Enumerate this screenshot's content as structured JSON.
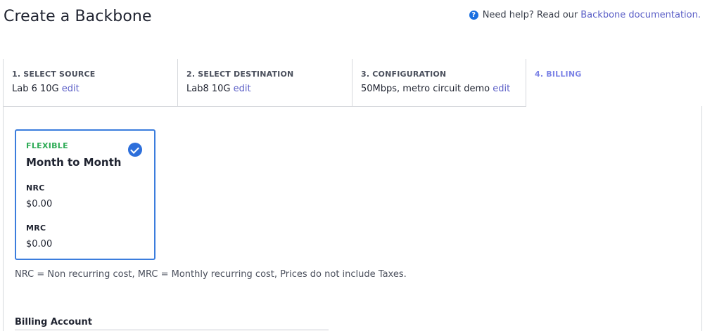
{
  "header": {
    "title": "Create a Backbone",
    "help_prefix": "Need help? Read our",
    "help_link": "Backbone documentation."
  },
  "steps": [
    {
      "label": "1. SELECT SOURCE",
      "value": "Lab 6 10G",
      "edit": "edit"
    },
    {
      "label": "2. SELECT DESTINATION",
      "value": "Lab8 10G",
      "edit": "edit"
    },
    {
      "label": "3. CONFIGURATION",
      "value": "50Mbps, metro circuit demo",
      "edit": "edit"
    },
    {
      "label": "4. BILLING"
    }
  ],
  "progress_fraction": 0.875,
  "plan": {
    "type": "FLEXIBLE",
    "name": "Month to Month",
    "nrc_label": "NRC",
    "nrc_value": "$0.00",
    "mrc_label": "MRC",
    "mrc_value": "$0.00",
    "selected": true
  },
  "note": "NRC = Non recurring cost, MRC = Monthly recurring cost, Prices do not include Taxes.",
  "billing": {
    "label": "Billing Account"
  },
  "colors": {
    "accent": "#8189e8",
    "selected_border": "#3b7ddd",
    "flexible_green": "#2dab55",
    "link": "#5b5fc7"
  }
}
